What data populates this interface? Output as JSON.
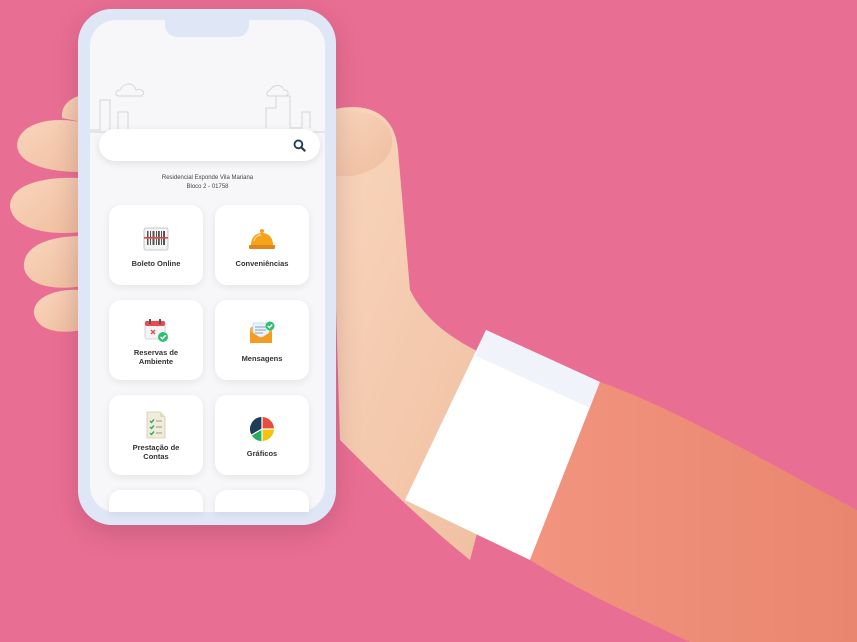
{
  "scene": {
    "background_color": "#e96e93"
  },
  "search": {
    "placeholder": "",
    "icon": "search-icon"
  },
  "address": {
    "line1": "Residencial Exponde Vila Mariana",
    "line2": "Bloco 2 - 01758"
  },
  "menu": {
    "items": [
      {
        "label": "Boleto Online",
        "icon": "barcode-icon"
      },
      {
        "label": "Conveniências",
        "icon": "service-bell-icon"
      },
      {
        "label": "Reservas de Ambiente",
        "icon": "calendar-check-icon"
      },
      {
        "label": "Mensagens",
        "icon": "envelope-check-icon"
      },
      {
        "label": "Prestação de Contas",
        "icon": "checklist-document-icon"
      },
      {
        "label": "Gráficos",
        "icon": "pie-chart-icon"
      }
    ]
  }
}
